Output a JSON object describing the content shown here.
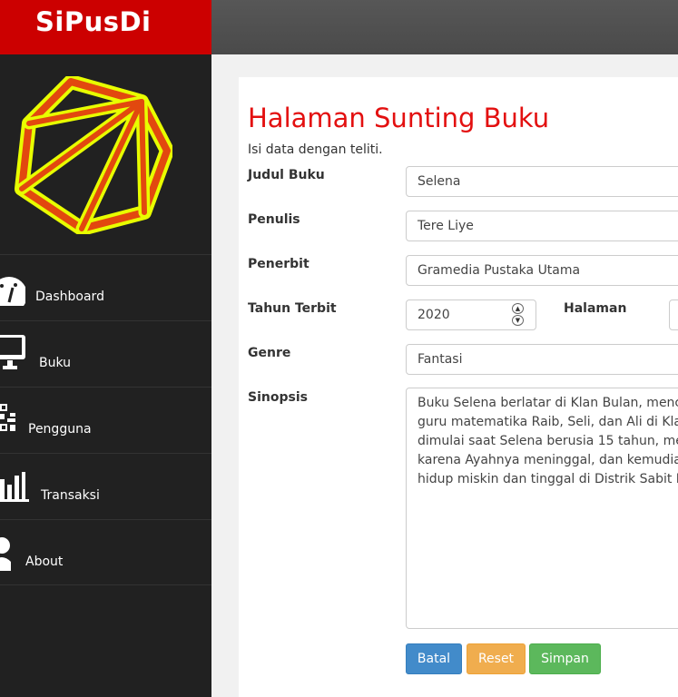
{
  "app": {
    "title": "SiPusDi"
  },
  "colors": {
    "brand": "#cc0000",
    "sidebar": "#212121",
    "title": "#e31010"
  },
  "sidebar": {
    "items": [
      {
        "label": "Dashboard",
        "icon": "dashboard-gauge-icon"
      },
      {
        "label": "Buku",
        "icon": "monitor-icon"
      },
      {
        "label": "Pengguna",
        "icon": "qr-code-icon"
      },
      {
        "label": "Transaksi",
        "icon": "bar-chart-icon"
      },
      {
        "label": "About",
        "icon": "user-icon"
      }
    ]
  },
  "form": {
    "title": "Halaman Sunting Buku",
    "subtitle": "Isi data dengan teliti.",
    "judul": {
      "label": "Judul Buku",
      "value": "Selena"
    },
    "penulis": {
      "label": "Penulis",
      "value": "Tere Liye"
    },
    "penerbit": {
      "label": "Penerbit",
      "value": "Gramedia Pustaka Utama"
    },
    "tahun": {
      "label": "Tahun Terbit",
      "value": "2020"
    },
    "halaman": {
      "label": "Halaman",
      "value": ""
    },
    "genre": {
      "label": "Genre",
      "value": "Fantasi"
    },
    "sinopsis": {
      "label": "Sinopsis",
      "lines": [
        "Buku Selena berlatar di Klan Bulan, menc",
        "guru matematika Raib, Seli, dan Ali di Kla",
        "dimulai saat Selena berusia 15 tahun, me",
        "karena Ayahnya meninggal, dan kemudia",
        "hidup miskin dan tinggal di Distrik Sabit I"
      ]
    },
    "buttons": {
      "batal": "Batal",
      "reset": "Reset",
      "simpan": "Simpan"
    }
  }
}
